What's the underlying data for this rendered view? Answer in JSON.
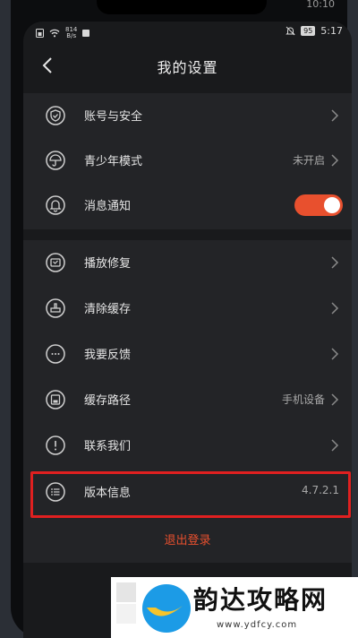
{
  "outer_status": {
    "time": "10:10"
  },
  "status_bar": {
    "speed_value": "814",
    "speed_unit": "B/s",
    "battery": "95",
    "time": "5:17"
  },
  "nav": {
    "title": "我的设置"
  },
  "settings_group_1": [
    {
      "label": "账号与安全",
      "value": "",
      "icon": "shield-check-icon"
    },
    {
      "label": "青少年模式",
      "value": "未开启",
      "icon": "umbrella-icon"
    },
    {
      "label": "消息通知",
      "value": "",
      "icon": "bell-icon",
      "toggle_on": true
    }
  ],
  "settings_group_2": [
    {
      "label": "播放修复",
      "value": "",
      "icon": "media-repair-icon"
    },
    {
      "label": "清除缓存",
      "value": "",
      "icon": "broom-icon"
    },
    {
      "label": "我要反馈",
      "value": "",
      "icon": "chat-bubble-icon"
    },
    {
      "label": "缓存路径",
      "value": "手机设备",
      "icon": "storage-icon"
    },
    {
      "label": "联系我们",
      "value": "",
      "icon": "info-icon"
    },
    {
      "label": "版本信息",
      "value": "4.7.2.1",
      "icon": "list-icon"
    }
  ],
  "logout_label": "退出登录",
  "accent_color": "#e8502e",
  "watermark": {
    "text": "韵达攻略网",
    "url": "www.ydfcy.com"
  }
}
